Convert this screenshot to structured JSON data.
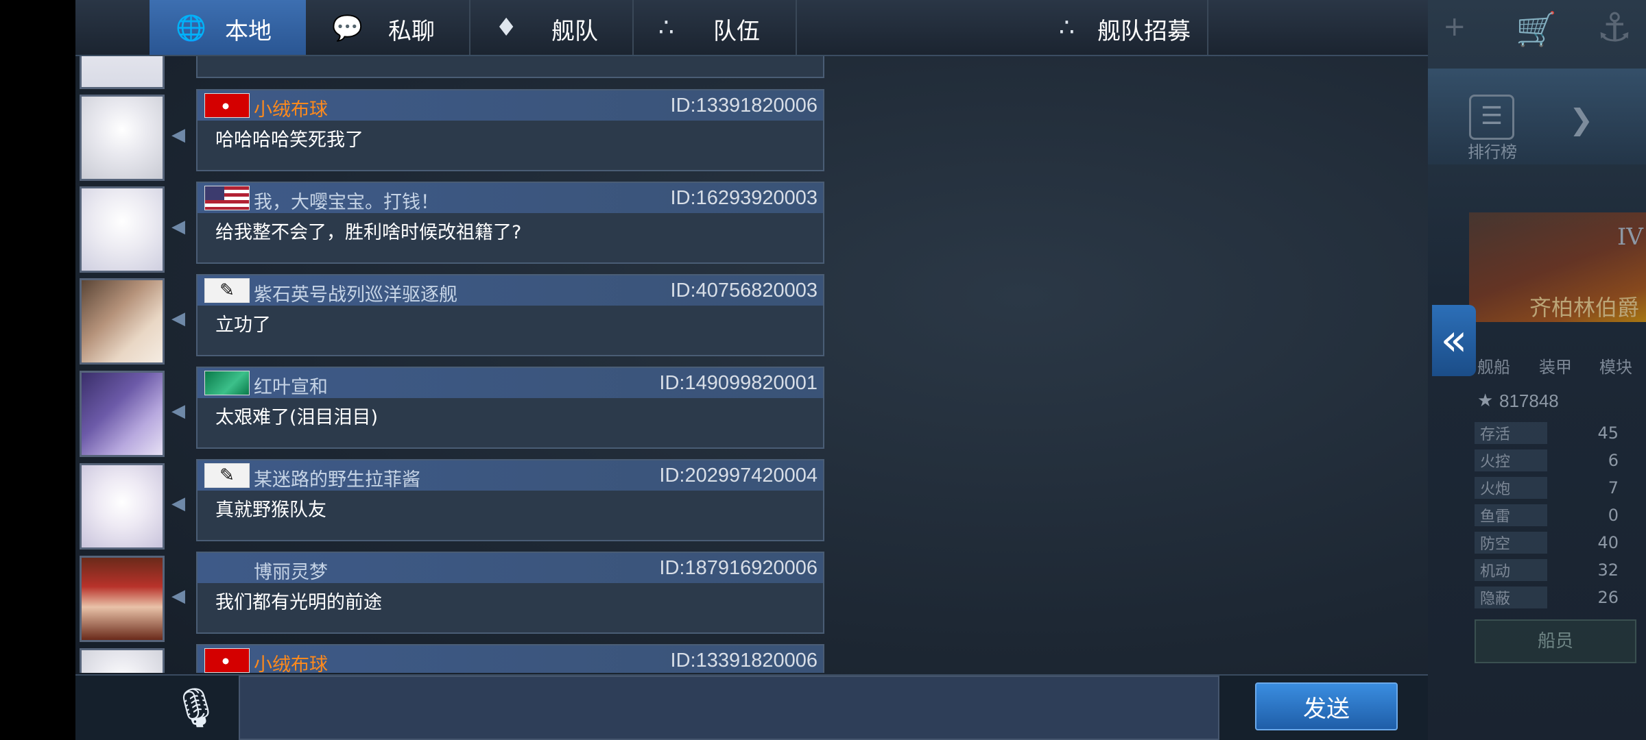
{
  "tabs": [
    {
      "label": "本地",
      "icon": "globe-icon",
      "active": true
    },
    {
      "label": "私聊",
      "icon": "speech-bubble-icon",
      "active": false
    },
    {
      "label": "舰队",
      "icon": "fleet-emblem-icon",
      "active": false
    },
    {
      "label": "队伍",
      "icon": "team-dots-icon",
      "active": false
    },
    {
      "label": "舰队招募",
      "icon": "team-dots-icon",
      "active": false
    }
  ],
  "messages": [
    {
      "name": "小绒布球",
      "name_color": "#ff8a1c",
      "id": "ID:13391820006",
      "text": "哈哈哈哈笑死我了",
      "flag": "swiss-flag"
    },
    {
      "name": "我，大嘤宝宝。打钱！",
      "name_color": "#c6d4e6",
      "id": "ID:16293920003",
      "text": "给我整不会了，胜利啥时候改祖籍了?",
      "flag": "usa-flag"
    },
    {
      "name": "紫石英号战列巡洋驱逐舰",
      "name_color": "#c6d4e6",
      "id": "ID:40756820003",
      "text": "立功了",
      "flag": "calligraphy-flag"
    },
    {
      "name": "红叶宣和",
      "name_color": "#c6d4e6",
      "id": "ID:149099820001",
      "text": "太艰难了(泪目泪目)",
      "flag": "green-wave-flag"
    },
    {
      "name": "某迷路的野生拉菲酱",
      "name_color": "#c6d4e6",
      "id": "ID:202997420004",
      "text": "真就野猴队友",
      "flag": "calligraphy-flag"
    },
    {
      "name": "博丽灵梦",
      "name_color": "#c6d4e6",
      "id": "ID:187916920006",
      "text": "我们都有光明的前途",
      "flag": "none"
    },
    {
      "name": "小绒布球",
      "name_color": "#ff8a1c",
      "id": "ID:13391820006",
      "text": "",
      "flag": "swiss-flag"
    }
  ],
  "input": {
    "placeholder": "",
    "value": ""
  },
  "send_label": "发送",
  "side_panel": {
    "score": "817848",
    "ship_name": "齐柏林伯爵",
    "tier": "IV",
    "rank_label": "排行榜",
    "tabs": [
      "舰船",
      "装甲",
      "模块"
    ],
    "stats": [
      {
        "label": "存活",
        "value": "45"
      },
      {
        "label": "火控",
        "value": "6"
      },
      {
        "label": "火炮",
        "value": "7"
      },
      {
        "label": "鱼雷",
        "value": "0"
      },
      {
        "label": "防空",
        "value": "40"
      },
      {
        "label": "机动",
        "value": "32"
      },
      {
        "label": "隐蔽",
        "value": "26"
      }
    ],
    "crew_label": "船员"
  },
  "colors": {
    "accent": "#3d6fb1",
    "orange_name": "#ff8a1c"
  }
}
